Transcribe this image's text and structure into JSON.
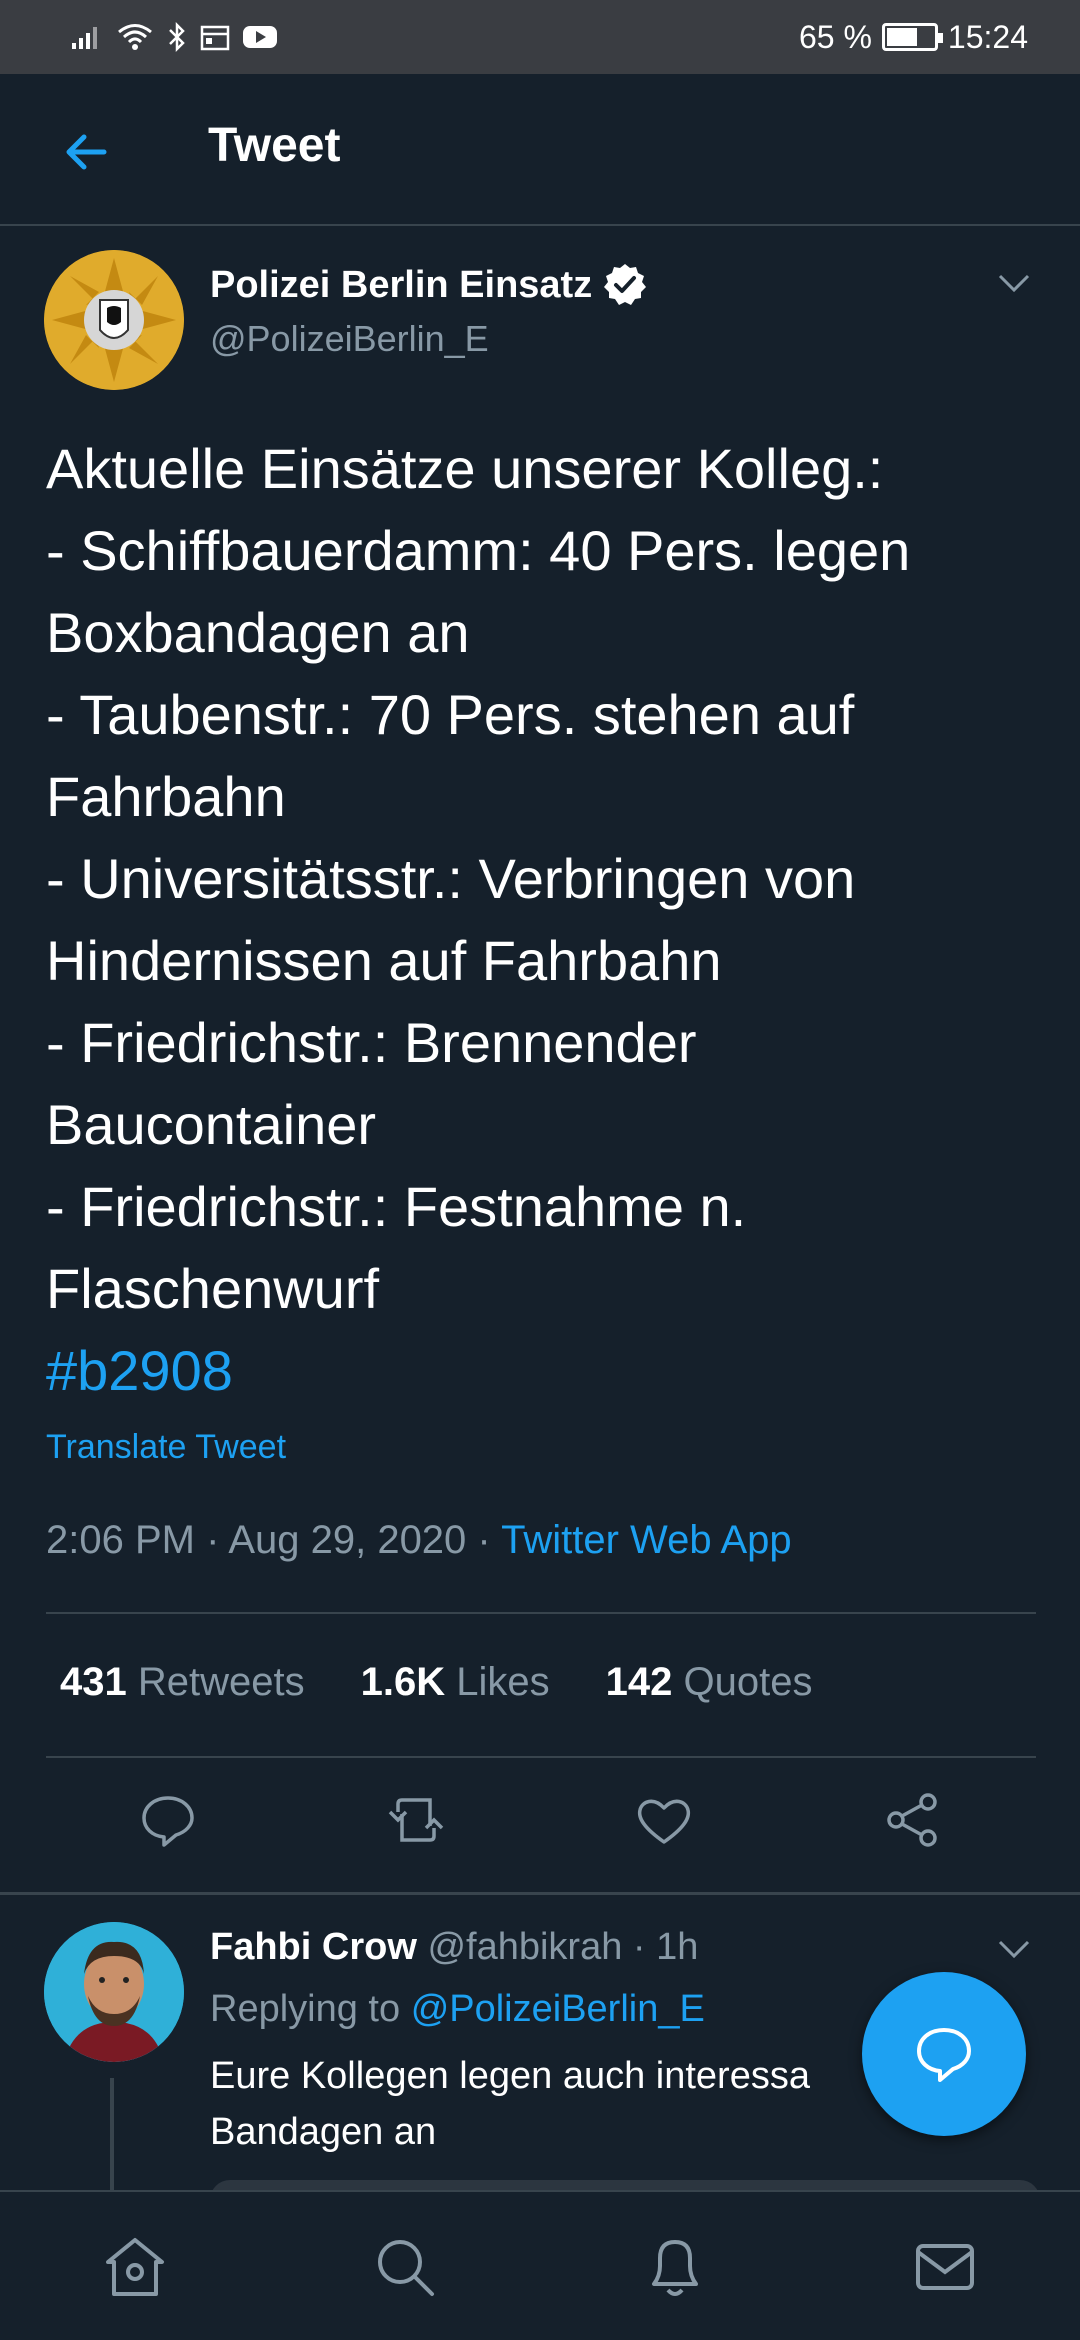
{
  "status_bar": {
    "battery": "65 %",
    "time": "15:24"
  },
  "header": {
    "title": "Tweet"
  },
  "tweet": {
    "author_name": "Polizei Berlin Einsatz",
    "author_handle": "@PolizeiBerlin_E",
    "lines": [
      "Aktuelle Einsätze unserer Kolleg.:",
      "- Schiffbauerdamm: 40 Pers. legen",
      "Boxbandagen an",
      "- Taubenstr.: 70 Pers. stehen auf",
      "Fahrbahn",
      "- Universitätsstr.: Verbringen von",
      "Hindernissen auf Fahrbahn",
      "- Friedrichstr.: Brennender",
      "Baucontainer",
      "- Friedrichstr.: Festnahme n.",
      "Flaschenwurf"
    ],
    "hashtag": "#b2908",
    "translate_label": "Translate Tweet",
    "time": "2:06 PM",
    "date": "Aug 29, 2020",
    "source": "Twitter Web App",
    "separator": " · ",
    "stats": {
      "retweets_count": "431",
      "retweets_label": "Retweets",
      "likes_count": "1.6K",
      "likes_label": "Likes",
      "quotes_count": "142",
      "quotes_label": "Quotes"
    }
  },
  "reply": {
    "name": "Fahbi Crow",
    "handle": "@fahbikrah",
    "time": "1h",
    "replying_label": "Replying to",
    "replying_to": "@PolizeiBerlin_E",
    "text_line1": "Eure Kollegen legen auch interessa",
    "text_line2": "Bandagen an"
  },
  "colors": {
    "background": "#15202b",
    "accent": "#1da1f2",
    "secondary_text": "#8899a6",
    "divider": "#38444d"
  },
  "icons": {
    "back": "arrow-left-icon",
    "verified": "verified-badge-icon",
    "caret": "chevron-down-icon",
    "reply": "comment-icon",
    "retweet": "retweet-icon",
    "like": "heart-icon",
    "share": "share-icon",
    "fab": "compose-reply-icon",
    "nav_home": "home-icon",
    "nav_search": "search-icon",
    "nav_notifications": "bell-icon",
    "nav_messages": "mail-icon"
  }
}
